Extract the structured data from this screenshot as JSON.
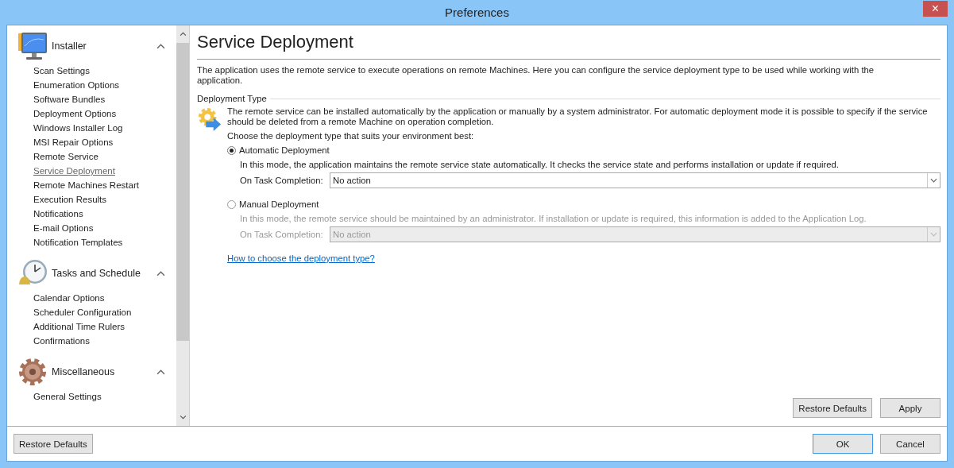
{
  "window": {
    "title": "Preferences",
    "close": "×"
  },
  "sidebar": {
    "groups": [
      {
        "title": "Installer",
        "expanded": true,
        "items": [
          {
            "label": "Scan Settings",
            "selected": false
          },
          {
            "label": "Enumeration Options",
            "selected": false
          },
          {
            "label": "Software Bundles",
            "selected": false
          },
          {
            "label": "Deployment Options",
            "selected": false
          },
          {
            "label": "Windows Installer Log",
            "selected": false
          },
          {
            "label": "MSI Repair Options",
            "selected": false
          },
          {
            "label": "Remote Service",
            "selected": false
          },
          {
            "label": "Service Deployment",
            "selected": true
          },
          {
            "label": "Remote Machines Restart",
            "selected": false
          },
          {
            "label": "Execution Results",
            "selected": false
          },
          {
            "label": "Notifications",
            "selected": false
          },
          {
            "label": "E-mail Options",
            "selected": false
          },
          {
            "label": "Notification Templates",
            "selected": false
          }
        ]
      },
      {
        "title": "Tasks and Schedule",
        "expanded": true,
        "items": [
          {
            "label": "Calendar Options",
            "selected": false
          },
          {
            "label": "Scheduler Configuration",
            "selected": false
          },
          {
            "label": "Additional Time Rulers",
            "selected": false
          },
          {
            "label": "Confirmations",
            "selected": false
          }
        ]
      },
      {
        "title": "Miscellaneous",
        "expanded": true,
        "items": [
          {
            "label": "General Settings",
            "selected": false
          }
        ]
      }
    ],
    "restore_button": "Restore Defaults"
  },
  "page": {
    "title": "Service Deployment",
    "intro": "The application uses the remote service to execute operations on remote Machines. Here you can configure the service deployment type to be used while working with the application.",
    "section": {
      "title": "Deployment Type",
      "description": "The remote service can be installed automatically by the application or manually by a system administrator. For automatic deployment mode it is possible to specify if the service should be deleted from a remote Machine on operation completion.",
      "prompt": "Choose the deployment type that suits your environment best:",
      "options": [
        {
          "label": "Automatic Deployment",
          "selected": true,
          "disabled": false,
          "description": "In this mode, the application maintains the remote service state automatically. It checks the service state and performs installation or update if required.",
          "field_label": "On Task Completion:",
          "field_value": "No action"
        },
        {
          "label": "Manual Deployment",
          "selected": false,
          "disabled": true,
          "description": "In this mode, the remote service should be maintained by an administrator. If installation or update is required, this information is added to the Application Log.",
          "field_label": "On Task Completion:",
          "field_value": "No action"
        }
      ],
      "help_link": "How to choose the deployment type?"
    },
    "buttons": [
      "Restore Defaults",
      "Apply"
    ]
  },
  "footer": {
    "buttons": [
      {
        "label": "OK",
        "selected": true
      },
      {
        "label": "Cancel",
        "selected": false
      }
    ]
  }
}
